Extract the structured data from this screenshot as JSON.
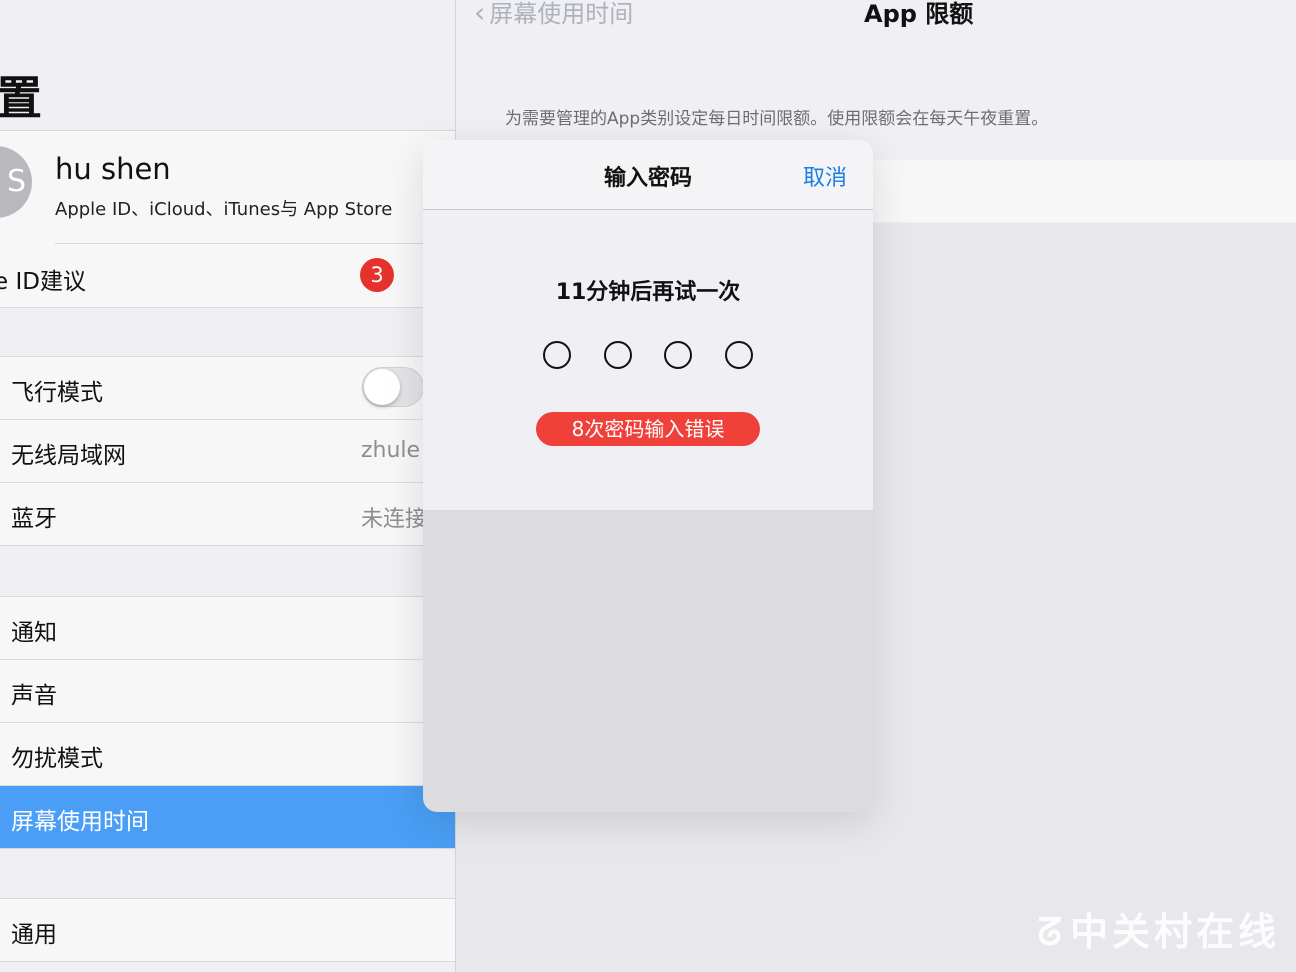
{
  "left_pane": {
    "title": "置",
    "profile": {
      "avatar_initial": "S",
      "name": "hu shen",
      "subtitle": "Apple ID、iCloud、iTunes与 App Store"
    },
    "apple_id_suggestions": {
      "label": "e ID建议",
      "badge": "3"
    },
    "group_network": [
      {
        "label": "飞行模式",
        "toggle_on": false
      },
      {
        "label": "无线局域网",
        "value": "zhule"
      },
      {
        "label": "蓝牙",
        "value": "未连接"
      }
    ],
    "group_notifications": [
      {
        "label": "通知"
      },
      {
        "label": "声音"
      },
      {
        "label": "勿扰模式"
      },
      {
        "label": "屏幕使用时间",
        "selected": true
      }
    ],
    "group_general": [
      {
        "label": "通用"
      }
    ]
  },
  "right_pane": {
    "back_label": "屏幕使用时间",
    "title": "App 限额",
    "description": "为需要管理的App类别设定每日时间限额。使用限额会在每天午夜重置。"
  },
  "passcode_modal": {
    "title": "输入密码",
    "cancel_label": "取消",
    "retry_message": "11分钟后再试一次",
    "digit_count": 4,
    "error_message": "8次密码输入错误"
  },
  "watermark": "中关村在线",
  "colors": {
    "accent_blue": "#1a7ee8",
    "selected_row": "#4a9ef5",
    "error_red": "#f0403a",
    "badge_red": "#e5322d"
  }
}
